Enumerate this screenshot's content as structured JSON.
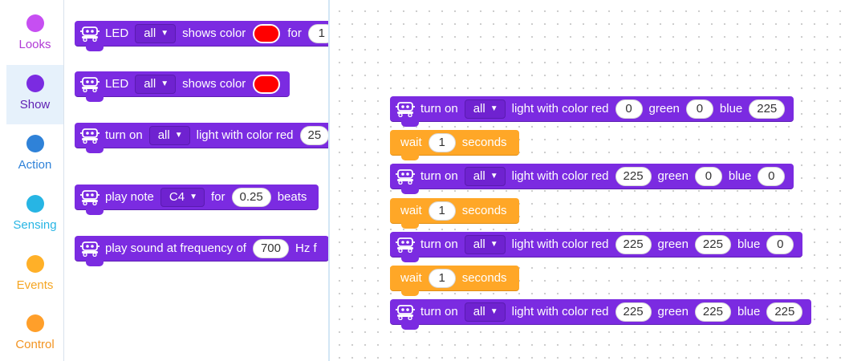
{
  "sidebar": {
    "items": [
      {
        "label": "Looks",
        "color": "#c64ff2",
        "text_color": "#b03ad6"
      },
      {
        "label": "Show",
        "color": "#7b2be1",
        "text_color": "#5e1fb3"
      },
      {
        "label": "Action",
        "color": "#2f82d8",
        "text_color": "#2f82d8"
      },
      {
        "label": "Sensing",
        "color": "#27b5e4",
        "text_color": "#27b5e4"
      },
      {
        "label": "Events",
        "color": "#ffb028",
        "text_color": "#f5a623"
      },
      {
        "label": "Control",
        "color": "#ff9f2a",
        "text_color": "#f29422"
      }
    ]
  },
  "colors": {
    "show_block": "#7b2be1",
    "control_block": "#ffa727",
    "red_swatch": "#ff0000"
  },
  "palette": {
    "led_shows_for": {
      "led": "LED",
      "target": "all",
      "shows_color": "shows color",
      "for": "for",
      "duration": "1"
    },
    "led_shows": {
      "led": "LED",
      "target": "all",
      "shows_color": "shows color"
    },
    "turn_on_rgb": {
      "turn_on": "turn on",
      "target": "all",
      "light_with_color_red": "light with color red",
      "red": "25"
    },
    "play_note": {
      "play_note": "play note",
      "note": "C4",
      "for": "for",
      "beats_value": "0.25",
      "beats": "beats"
    },
    "play_sound": {
      "label": "play sound at frequency of",
      "freq": "700",
      "hz": "Hz f"
    }
  },
  "workspace": {
    "script": [
      {
        "type": "rgb",
        "turn_on": "turn on",
        "target": "all",
        "light_with_color_red": "light with color red",
        "red": "0",
        "green_label": "green",
        "green": "0",
        "blue_label": "blue",
        "blue": "225"
      },
      {
        "type": "wait",
        "wait": "wait",
        "seconds_value": "1",
        "seconds": "seconds"
      },
      {
        "type": "rgb",
        "turn_on": "turn on",
        "target": "all",
        "light_with_color_red": "light with color red",
        "red": "225",
        "green_label": "green",
        "green": "0",
        "blue_label": "blue",
        "blue": "0"
      },
      {
        "type": "wait",
        "wait": "wait",
        "seconds_value": "1",
        "seconds": "seconds"
      },
      {
        "type": "rgb",
        "turn_on": "turn on",
        "target": "all",
        "light_with_color_red": "light with color red",
        "red": "225",
        "green_label": "green",
        "green": "225",
        "blue_label": "blue",
        "blue": "0"
      },
      {
        "type": "wait",
        "wait": "wait",
        "seconds_value": "1",
        "seconds": "seconds"
      },
      {
        "type": "rgb",
        "turn_on": "turn on",
        "target": "all",
        "light_with_color_red": "light with color red",
        "red": "225",
        "green_label": "green",
        "green": "225",
        "blue_label": "blue",
        "blue": "225"
      }
    ]
  }
}
